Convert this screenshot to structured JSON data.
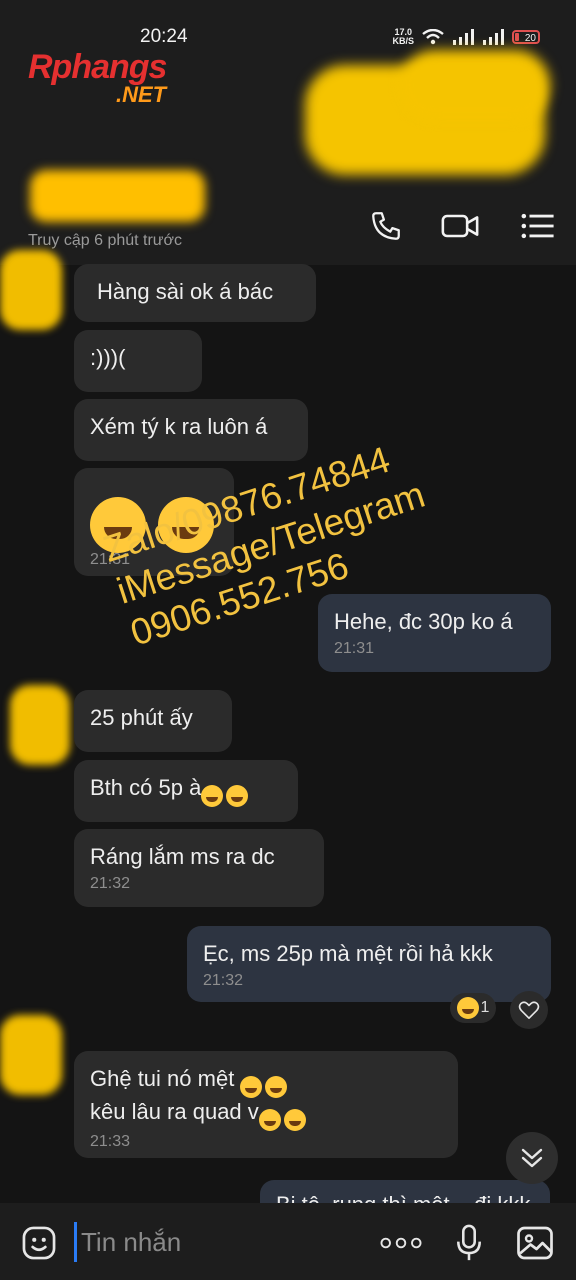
{
  "status": {
    "time": "20:24",
    "netspeed_value": "17.0",
    "netspeed_unit": "KB/S",
    "battery": "20"
  },
  "logo": {
    "line1": "Rphangs",
    "line2": ".NET"
  },
  "header": {
    "last_seen": "Truy cập 6 phút trước"
  },
  "messages": [
    {
      "text": "Hàng sài ok á bác"
    },
    {
      "text": ":)))("
    },
    {
      "text": "Xém tý k ra luôn á"
    },
    {
      "time": "21:31"
    },
    {
      "text": "Hehe, đc 30p ko á",
      "time": "21:31"
    },
    {
      "text": "25 phút ấy"
    },
    {
      "text": "Bth có 5p à"
    },
    {
      "text": "Ráng lắm ms ra dc",
      "time": "21:32"
    },
    {
      "text": "Ẹc, ms 25p mà mệt rồi hả kkk",
      "time": "21:32"
    },
    {
      "text": "Ghệ tui nó mệt ",
      "text2": "kêu lâu ra quad v",
      "time": "21:33"
    },
    {
      "text": "Bị tê, rụng thì mệt... đi kkk"
    }
  ],
  "reaction": {
    "count": "1"
  },
  "watermark": {
    "line1": "Zalo/09876.74844",
    "line2": "iMessage/Telegram",
    "line3": "0906.552.756"
  },
  "composer": {
    "placeholder": "Tin nhắn"
  },
  "icons": [
    "phone-icon",
    "video-call-icon",
    "menu-icon",
    "heart-icon",
    "chevron-down-icon",
    "sticker-icon",
    "more-icon",
    "mic-icon",
    "image-icon"
  ]
}
